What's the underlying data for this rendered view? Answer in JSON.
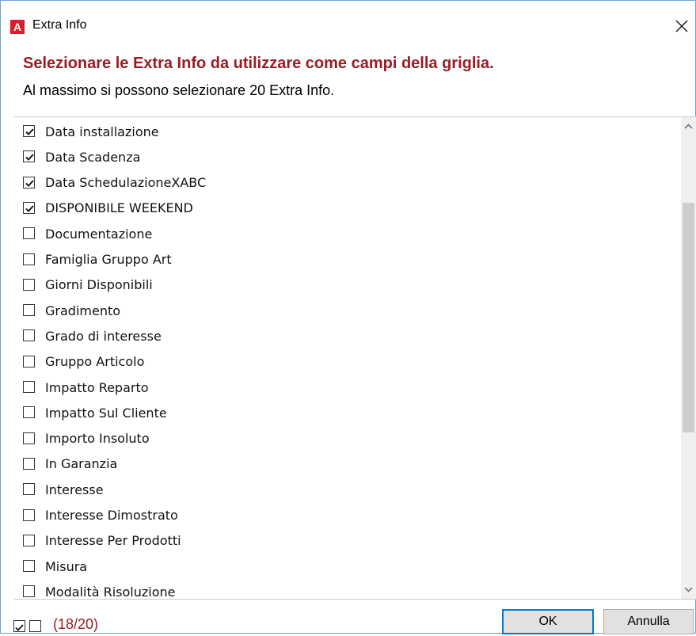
{
  "window": {
    "title": "Extra Info",
    "app_icon_letter": "A",
    "close_icon": "close-icon"
  },
  "header": {
    "heading": "Selezionare le Extra Info da utilizzare come campi della griglia.",
    "subheading": "Al massimo si possono selezionare 20 Extra Info."
  },
  "list": {
    "items": [
      {
        "label": "Data installazione",
        "checked": true
      },
      {
        "label": "Data Scadenza",
        "checked": true
      },
      {
        "label": "Data SchedulazioneXABC",
        "checked": true
      },
      {
        "label": "DISPONIBILE WEEKEND",
        "checked": true
      },
      {
        "label": "Documentazione",
        "checked": false
      },
      {
        "label": "Famiglia Gruppo Art",
        "checked": false
      },
      {
        "label": "Giorni Disponibili",
        "checked": false
      },
      {
        "label": "Gradimento",
        "checked": false
      },
      {
        "label": "Grado di interesse",
        "checked": false
      },
      {
        "label": "Gruppo Articolo",
        "checked": false
      },
      {
        "label": "Impatto Reparto",
        "checked": false
      },
      {
        "label": "Impatto Sul Cliente",
        "checked": false
      },
      {
        "label": "Importo Insoluto",
        "checked": false
      },
      {
        "label": "In Garanzia",
        "checked": false
      },
      {
        "label": "Interesse",
        "checked": false
      },
      {
        "label": "Interesse Dimostrato",
        "checked": false
      },
      {
        "label": "Interesse Per Prodotti",
        "checked": false
      },
      {
        "label": "Misura",
        "checked": false
      },
      {
        "label": "Modalità Risoluzione",
        "checked": false
      }
    ]
  },
  "footer": {
    "counter": "(18/20)",
    "ok_label": "OK",
    "cancel_label": "Annulla"
  },
  "colors": {
    "accent_red": "#9b1b24",
    "focus_blue": "#0078d7"
  }
}
